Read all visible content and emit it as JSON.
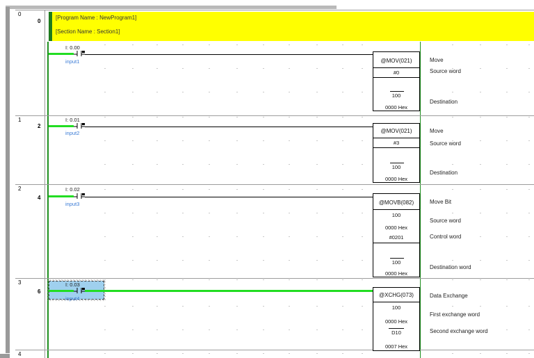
{
  "header": {
    "program_name": "[Program Name : NewProgram1]",
    "section_name": "[Section Name : Section1]"
  },
  "rungs": [
    {
      "rung": "0",
      "step": "0",
      "contact_addr": "I: 0.00",
      "contact_symbol": "input1",
      "instruction": "@MOV(021)",
      "operands": [
        "#0",
        "100",
        "0000 Hex"
      ],
      "comments": [
        "Move",
        "Source word",
        "Destination"
      ]
    },
    {
      "rung": "1",
      "step": "2",
      "contact_addr": "I: 0.01",
      "contact_symbol": "input2",
      "instruction": "@MOV(021)",
      "operands": [
        "#3",
        "100",
        "0000 Hex"
      ],
      "comments": [
        "Move",
        "Source word",
        "Destination"
      ]
    },
    {
      "rung": "2",
      "step": "4",
      "contact_addr": "I: 0.02",
      "contact_symbol": "input3",
      "instruction": "@MOVB(082)",
      "operands": [
        "100",
        "0000 Hex",
        "#0201",
        "100",
        "0000 Hex"
      ],
      "comments": [
        "Move Bit",
        "Source word",
        "Control word",
        "Destination word"
      ]
    },
    {
      "rung": "3",
      "step": "6",
      "contact_addr": "I: 0.03",
      "contact_symbol": "input4",
      "instruction": "@XCHG(073)",
      "operands": [
        "100",
        "0000 Hex",
        "D10",
        "0007 Hex"
      ],
      "comments": [
        "Data Exchange",
        "First exchange word",
        "Second exchange word"
      ]
    }
  ],
  "next_rung": "4",
  "colors": {
    "header_band": "#ffff00",
    "rail_green": "#1e8f1e",
    "energized_wire": "#22dd22",
    "symbol_blue": "#3a7bd5",
    "selection": "#9fd0ee"
  }
}
